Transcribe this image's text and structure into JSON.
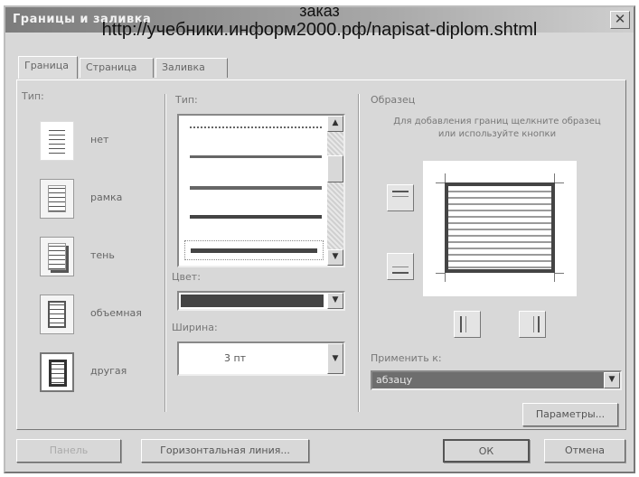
{
  "overlay": {
    "line1": "заказ",
    "line2": "http://учебники.информ2000.рф/napisat-diplom.shtml"
  },
  "window": {
    "title": "Границы и заливка",
    "close_glyph": "✕"
  },
  "tabs": [
    {
      "label": "Граница"
    },
    {
      "label": "Страница"
    },
    {
      "label": "Заливка"
    }
  ],
  "type_section": {
    "label": "Тип:",
    "items": [
      {
        "label": "нет"
      },
      {
        "label": "рамка"
      },
      {
        "label": "тень"
      },
      {
        "label": "объемная"
      },
      {
        "label": "другая"
      }
    ]
  },
  "line_section": {
    "label": "Тип:",
    "color_label": "Цвет:",
    "width_label": "Ширина:",
    "width_value": "3 пт",
    "color_hex": "#444444"
  },
  "sample_section": {
    "label": "Образец",
    "hint": "Для добавления границ щелкните образец или используйте кнопки"
  },
  "apply": {
    "label": "Применить к:",
    "value": "абзацу"
  },
  "buttons": {
    "options": "Параметры...",
    "panel": "Панель",
    "horizontal_line": "Горизонтальная линия...",
    "ok": "ОК",
    "cancel": "Отмена"
  },
  "icons": {
    "scroll_up": "▲",
    "scroll_down": "▼",
    "dropdown": "▼"
  }
}
